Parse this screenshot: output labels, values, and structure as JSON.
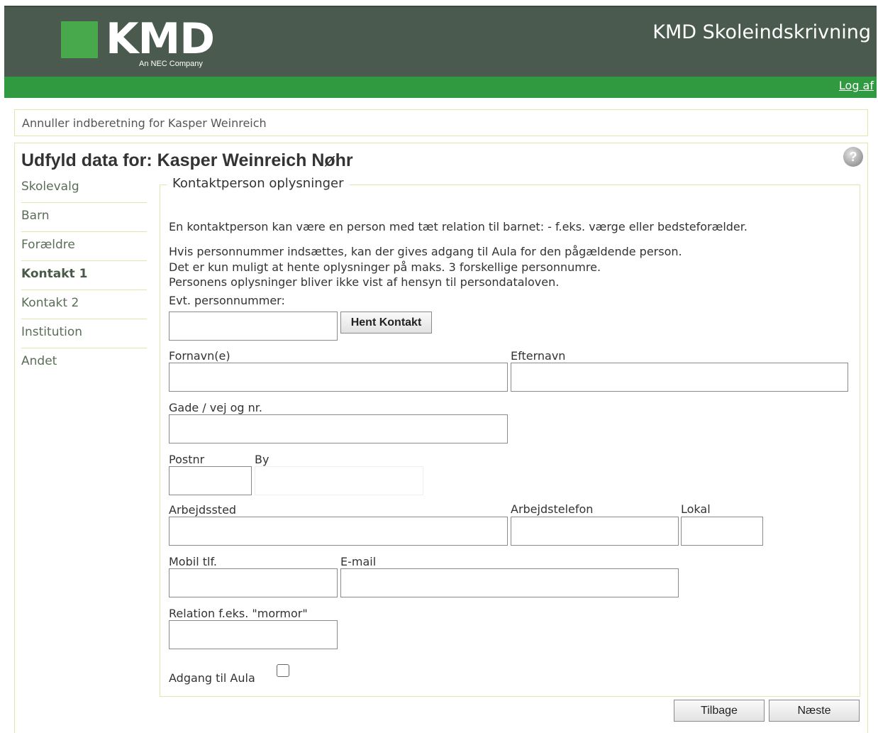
{
  "header": {
    "logo_text": "KMD",
    "logo_sub": "An NEC Company",
    "app_title": "KMD Skoleindskrivning",
    "logout": "Log af"
  },
  "cancel_link": "Annuller indberetning for Kasper Weinreich",
  "page_title": "Udfyld data for: Kasper Weinreich Nøhr",
  "help_icon": "?",
  "nav": {
    "items": [
      {
        "label": "Skolevalg"
      },
      {
        "label": "Barn"
      },
      {
        "label": "Forældre"
      },
      {
        "label": "Kontakt 1"
      },
      {
        "label": "Kontakt 2"
      },
      {
        "label": "Institution"
      },
      {
        "label": "Andet"
      }
    ],
    "active_index": 3
  },
  "form": {
    "legend": "Kontaktperson oplysninger",
    "intro": "En kontaktperson kan være en person med tæt relation til barnet: - f.eks. værge eller bedsteforælder.",
    "info_lines": [
      "Hvis personnummer indsættes, kan der gives adgang til Aula for den pågældende person.",
      "Det er kun muligt at hente oplysninger på maks. 3 forskellige personnumre.",
      "Personens oplysninger bliver ikke vist af hensyn til persondataloven."
    ],
    "cpr_label": "Evt. personnummer:",
    "cpr_value": "",
    "fetch_button": "Hent Kontakt",
    "firstname_label": "Fornavn(e)",
    "firstname_value": "",
    "lastname_label": "Efternavn",
    "lastname_value": "",
    "street_label": "Gade / vej og nr.",
    "street_value": "",
    "zip_label": "Postnr",
    "zip_value": "",
    "city_label": "By",
    "city_value": "",
    "workplace_label": "Arbejdssted",
    "workplace_value": "",
    "workphone_label": "Arbejdstelefon",
    "workphone_value": "",
    "local_label": "Lokal",
    "local_value": "",
    "mobile_label": "Mobil tlf.",
    "mobile_value": "",
    "email_label": "E-mail",
    "email_value": "",
    "relation_label": "Relation f.eks. \"mormor\"",
    "relation_value": "",
    "aula_label": "Adgang til Aula",
    "aula_checked": false
  },
  "footer": {
    "back_button": "Tilbage",
    "next_button": "Næste"
  },
  "colors": {
    "header_bg": "#4b5a4f",
    "green_bar": "#2f9a40",
    "logo_green": "#48a94c",
    "panel_border": "#dde8b0"
  }
}
